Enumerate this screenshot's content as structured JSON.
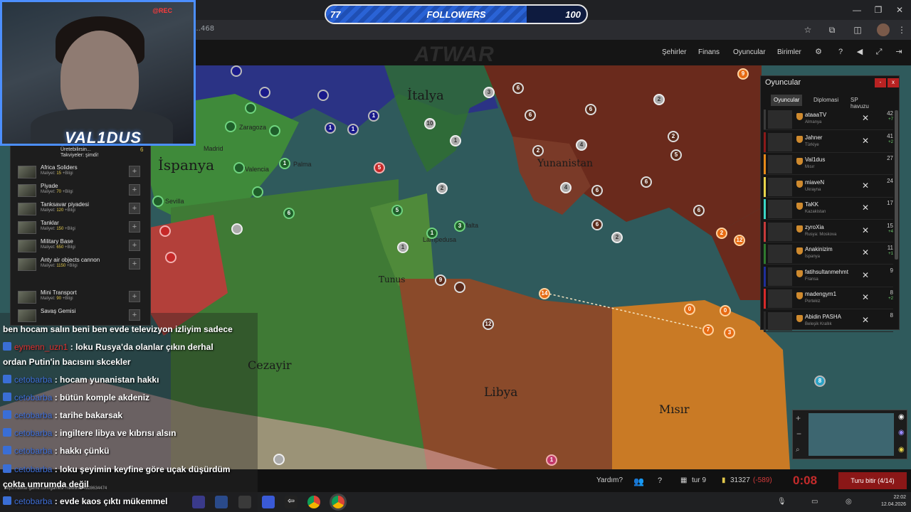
{
  "browser": {
    "url": "…468",
    "status_url": "https://atwar-game.com/games/?newlink=4928634474"
  },
  "followers": {
    "current": "77",
    "label": "FOLLOWERS",
    "goal": "100",
    "progress": 0.77
  },
  "game_nav": {
    "logo": "ATWAR",
    "links": [
      "Şehirler",
      "Finans",
      "Oyuncular",
      "Birimler"
    ]
  },
  "webcam": {
    "rec": "@REC",
    "brand": "VAL1DUS"
  },
  "build_panel": {
    "header_title": "Üretebilirsin...",
    "header_sub": "Takviyeler: şimdi!",
    "header_count": "6",
    "units": [
      {
        "name": "Africa Soliders",
        "cost_label": "Maliyet:",
        "cost": "15",
        "info": "+Bilgi"
      },
      {
        "name": "Piyade",
        "cost_label": "Maliyet:",
        "cost": "70",
        "info": "+Bilgi"
      },
      {
        "name": "Tanksavar piyadesi",
        "cost_label": "Maliyet:",
        "cost": "120",
        "info": "+Bilgi"
      },
      {
        "name": "Tanklar",
        "cost_label": "Maliyet:",
        "cost": "150",
        "info": "+Bilgi"
      },
      {
        "name": "Military Base",
        "cost_label": "Maliyet:",
        "cost": "650",
        "info": "+Bilgi"
      },
      {
        "name": "Anty air objects cannon",
        "cost_label": "Maliyet:",
        "cost": "1150",
        "info": "+Bilgi"
      },
      {
        "name": "Mini Transport",
        "cost_label": "Maliyet:",
        "cost": "90",
        "info": "+Bilgi"
      },
      {
        "name": "Savaş Gemisi",
        "cost_label": "",
        "cost": "",
        "info": ""
      }
    ]
  },
  "map": {
    "countries": [
      "İspanya",
      "İtalya",
      "Yunanistan",
      "Tunus",
      "Cezayir",
      "Libya",
      "Mısır"
    ],
    "cities": [
      "Madrid",
      "Valencia",
      "Sevilla",
      "Palma",
      "Malta",
      "Lampedusa",
      "Zaragoza"
    ]
  },
  "players_panel": {
    "title": "Oyuncular",
    "tabs": [
      "Oyuncular",
      "Diplomasi",
      "SP havuzu"
    ],
    "players": [
      {
        "name": "ataaaTV",
        "nation": "Almanya",
        "score": "42",
        "delta": "+7",
        "color": "#3a3a3a"
      },
      {
        "name": "Jahner",
        "nation": "Türkiye",
        "score": "41",
        "delta": "+2",
        "color": "#8b1a1a"
      },
      {
        "name": "Val1dus",
        "nation": "Mısır",
        "score": "27",
        "delta": "",
        "color": "#e68a1a"
      },
      {
        "name": "miaveN",
        "nation": "Ukrayna",
        "score": "24",
        "delta": "",
        "color": "#e8d44a"
      },
      {
        "name": "TaKK",
        "nation": "Kazakistan",
        "score": "17",
        "delta": "",
        "color": "#3ad6c6"
      },
      {
        "name": "zyroXia",
        "nation": "Rusya: Moskova",
        "score": "15",
        "delta": "+4",
        "color": "#c63a3a"
      },
      {
        "name": "Anakinizim",
        "nation": "İspanya",
        "score": "11",
        "delta": "+1",
        "color": "#2f7a2f"
      },
      {
        "name": "fatihsultanmehmt",
        "nation": "Fransa",
        "score": "9",
        "delta": "",
        "color": "#1f2f9a"
      },
      {
        "name": "madengym1",
        "nation": "Portekiz",
        "score": "8",
        "delta": "+2",
        "color": "#d62a2a"
      },
      {
        "name": "Abidin PASHA",
        "nation": "Beleşik Krallık",
        "score": "8",
        "delta": "",
        "color": "#2a2a2a"
      }
    ]
  },
  "chat": [
    {
      "user": "",
      "text": "ben hocam salın beni ben evde televizyon izliyim sadece"
    },
    {
      "user": "eymenn_uzn1",
      "text": ": loku Rusya'da olanlar çıkın derhal",
      "red": true
    },
    {
      "user": "",
      "text": "ordan Putin'in bacısını skcekler"
    },
    {
      "user": "cetobarba",
      "text": ": hocam yunanistan hakkı"
    },
    {
      "user": "cetobarba",
      "text": ": bütün komple akdeniz"
    },
    {
      "user": "cetobarba",
      "text": ": tarihe bakarsak"
    },
    {
      "user": "cetobarba",
      "text": ": ingiltere libya ve kıbrısı alsın"
    },
    {
      "user": "cetobarba",
      "text": ": hakkı çünkü"
    },
    {
      "user": "cetobarba",
      "text": ": loku şeyimin keyfine göre uçak düşürdüm"
    },
    {
      "user": "",
      "text": "çokta umrumda değil"
    },
    {
      "user": "cetobarba",
      "text": ": evde kaos çıktı mükemmel"
    }
  ],
  "bottom_bar": {
    "help": "Yardım?",
    "turn": "tur 9",
    "gold": "31327",
    "gold_delta": "(-589)",
    "timer": "0:08",
    "end_turn": "Turu bitir (4/14)"
  },
  "taskbar": {
    "time": "22:02",
    "date": "12.04.2026"
  }
}
